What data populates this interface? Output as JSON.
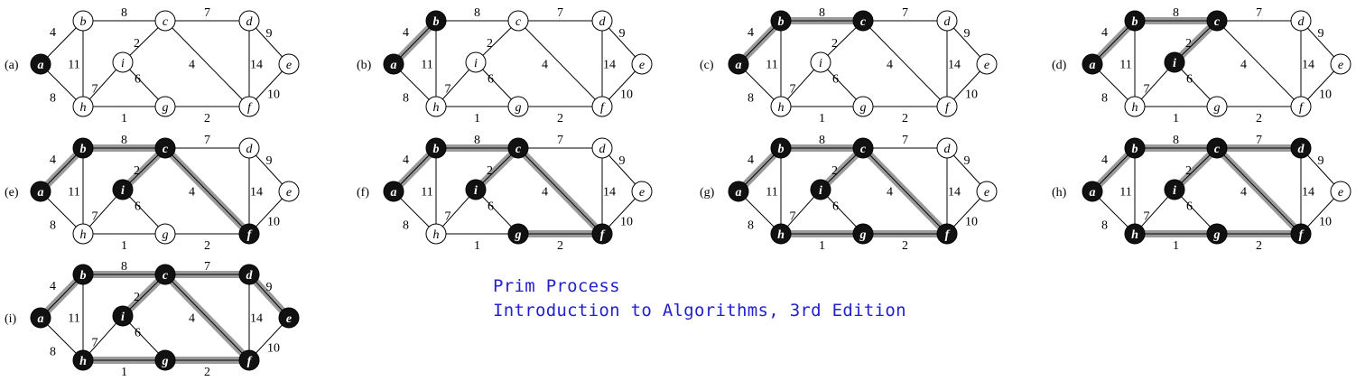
{
  "caption": {
    "line1": "Prim Process",
    "line2": "Introduction to Algorithms, 3rd Edition"
  },
  "graph": {
    "vertices": [
      "a",
      "b",
      "c",
      "d",
      "e",
      "f",
      "g",
      "h",
      "i"
    ],
    "edges": [
      {
        "u": "a",
        "v": "b",
        "w": "4"
      },
      {
        "u": "a",
        "v": "h",
        "w": "8"
      },
      {
        "u": "b",
        "v": "h",
        "w": "11"
      },
      {
        "u": "b",
        "v": "c",
        "w": "8"
      },
      {
        "u": "c",
        "v": "d",
        "w": "7"
      },
      {
        "u": "c",
        "v": "i",
        "w": "2"
      },
      {
        "u": "c",
        "v": "f",
        "w": "4"
      },
      {
        "u": "d",
        "v": "e",
        "w": "9"
      },
      {
        "u": "d",
        "v": "f",
        "w": "14"
      },
      {
        "u": "e",
        "v": "f",
        "w": "10"
      },
      {
        "u": "h",
        "v": "i",
        "w": "7"
      },
      {
        "u": "h",
        "v": "g",
        "w": "1"
      },
      {
        "u": "i",
        "v": "g",
        "w": "6"
      },
      {
        "u": "g",
        "v": "f",
        "w": "2"
      }
    ]
  },
  "panels": [
    {
      "label": "(a)",
      "black": [
        "a"
      ],
      "tree": []
    },
    {
      "label": "(b)",
      "black": [
        "a",
        "b"
      ],
      "tree": [
        "a-b"
      ]
    },
    {
      "label": "(c)",
      "black": [
        "a",
        "b",
        "c"
      ],
      "tree": [
        "a-b",
        "b-c"
      ]
    },
    {
      "label": "(d)",
      "black": [
        "a",
        "b",
        "c",
        "i"
      ],
      "tree": [
        "a-b",
        "b-c",
        "c-i"
      ]
    },
    {
      "label": "(e)",
      "black": [
        "a",
        "b",
        "c",
        "i",
        "f"
      ],
      "tree": [
        "a-b",
        "b-c",
        "c-i",
        "c-f"
      ]
    },
    {
      "label": "(f)",
      "black": [
        "a",
        "b",
        "c",
        "i",
        "f",
        "g"
      ],
      "tree": [
        "a-b",
        "b-c",
        "c-i",
        "c-f",
        "g-f"
      ]
    },
    {
      "label": "(g)",
      "black": [
        "a",
        "b",
        "c",
        "i",
        "f",
        "g",
        "h"
      ],
      "tree": [
        "a-b",
        "b-c",
        "c-i",
        "c-f",
        "g-f",
        "h-g"
      ]
    },
    {
      "label": "(h)",
      "black": [
        "a",
        "b",
        "c",
        "i",
        "f",
        "g",
        "h",
        "d"
      ],
      "tree": [
        "a-b",
        "b-c",
        "c-i",
        "c-f",
        "g-f",
        "h-g",
        "c-d"
      ]
    },
    {
      "label": "(i)",
      "black": [
        "a",
        "b",
        "c",
        "i",
        "f",
        "g",
        "h",
        "d",
        "e"
      ],
      "tree": [
        "a-b",
        "b-c",
        "c-i",
        "c-f",
        "g-f",
        "h-g",
        "c-d",
        "d-e"
      ]
    }
  ]
}
